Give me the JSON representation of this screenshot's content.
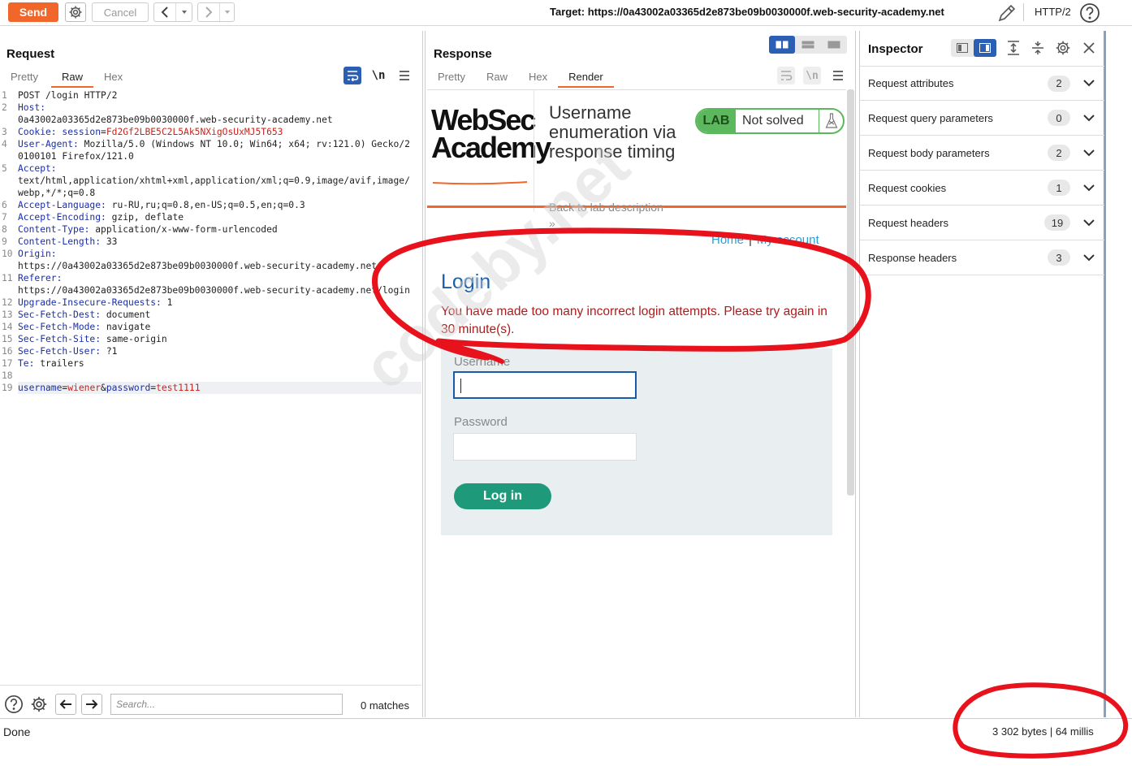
{
  "toolbar": {
    "send_label": "Send",
    "cancel_label": "Cancel",
    "target_text": "Target: https://0a43002a03365d2e873be09b0030000f.web-security-academy.net",
    "http_version": "HTTP/2"
  },
  "request": {
    "title": "Request",
    "tabs": [
      "Pretty",
      "Raw",
      "Hex"
    ],
    "active_tab": "Raw",
    "wrap_label": "\\n",
    "search_placeholder": "Search...",
    "matches_text": "0 matches",
    "lines": {
      "1": "POST /login HTTP/2",
      "2a": "Host:",
      "2b": "0a43002a03365d2e873be09b0030000f.web-security-academy.net",
      "3a": "Cookie:",
      "3b": "session",
      "3c": "Fd2Gf2LBE5C2L5Ak5NXigOsUxMJ5T653",
      "4a": "User-Agent:",
      "4b": "Mozilla/5.0 (Windows NT 10.0; Win64; x64; rv:121.0) Gecko/20100101 Firefox/121.0",
      "5a": "Accept:",
      "5b": "text/html,application/xhtml+xml,application/xml;q=0.9,image/avif,image/webp,*/*;q=0.8",
      "6a": "Accept-Language:",
      "6b": "ru-RU,ru;q=0.8,en-US;q=0.5,en;q=0.3",
      "7a": "Accept-Encoding:",
      "7b": "gzip, deflate",
      "8a": "Content-Type:",
      "8b": "application/x-www-form-urlencoded",
      "9a": "Content-Length:",
      "9b": "33",
      "10a": "Origin:",
      "10b": "https://0a43002a03365d2e873be09b0030000f.web-security-academy.net",
      "11a": "Referer:",
      "11b": "https://0a43002a03365d2e873be09b0030000f.web-security-academy.net/login",
      "12a": "Upgrade-Insecure-Requests:",
      "12b": "1",
      "13a": "Sec-Fetch-Dest:",
      "13b": "document",
      "14a": "Sec-Fetch-Mode:",
      "14b": "navigate",
      "15a": "Sec-Fetch-Site:",
      "15b": "same-origin",
      "16a": "Sec-Fetch-User:",
      "16b": "?1",
      "17a": "Te:",
      "17b": "trailers",
      "19_k1": "username",
      "19_v1": "wiener",
      "19_k2": "password",
      "19_v2": "test1111"
    }
  },
  "response": {
    "title": "Response",
    "tabs": [
      "Pretty",
      "Raw",
      "Hex",
      "Render"
    ],
    "active_tab": "Render",
    "wrap_label": "\\n",
    "render": {
      "logo_line1": "WebSec",
      "logo_line2": "Academy",
      "lab_title": "Username enumeration via response timing",
      "lab_badge": "LAB",
      "lab_status": "Not solved",
      "back_link": "Back to lab description",
      "chevron": "»",
      "nav_home": "Home",
      "nav_sep": "|",
      "nav_account": "My account",
      "login_heading": "Login",
      "error_message": "You have made too many incorrect login attempts. Please try again in 30 minute(s).",
      "username_label": "Username",
      "password_label": "Password",
      "login_button": "Log in"
    }
  },
  "inspector": {
    "title": "Inspector",
    "rows": [
      {
        "name": "Request attributes",
        "count": "2"
      },
      {
        "name": "Request query parameters",
        "count": "0"
      },
      {
        "name": "Request body parameters",
        "count": "2"
      },
      {
        "name": "Request cookies",
        "count": "1"
      },
      {
        "name": "Request headers",
        "count": "19"
      },
      {
        "name": "Response headers",
        "count": "3"
      }
    ]
  },
  "status": {
    "left": "Done",
    "right": "3 302 bytes | 64 millis"
  },
  "watermark": "codeby.net",
  "colors": {
    "accent": "#f1662a",
    "lab_green": "#5cb85c",
    "login_button": "#1e9a7a",
    "error_red": "#b01b1b",
    "header_blue": "#1a2fa8",
    "value_red": "#c8231c",
    "annotation_red": "#e8121c"
  }
}
